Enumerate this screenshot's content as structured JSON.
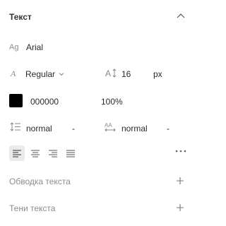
{
  "panel": {
    "title": "Текст"
  },
  "font": {
    "family": "Arial",
    "weight": "Regular",
    "size": "16",
    "size_unit": "px"
  },
  "color": {
    "swatch": "#000000",
    "hex": "000000",
    "opacity": "100%"
  },
  "spacing": {
    "line_height": "normal",
    "line_height_dash": "-",
    "letter_spacing": "normal",
    "letter_spacing_dash": "-"
  },
  "alignment": {
    "options": [
      "left",
      "center",
      "right",
      "justify"
    ],
    "selected": "left"
  },
  "sections": {
    "stroke_label": "Обводка текста",
    "shadow_label": "Тени текста"
  }
}
